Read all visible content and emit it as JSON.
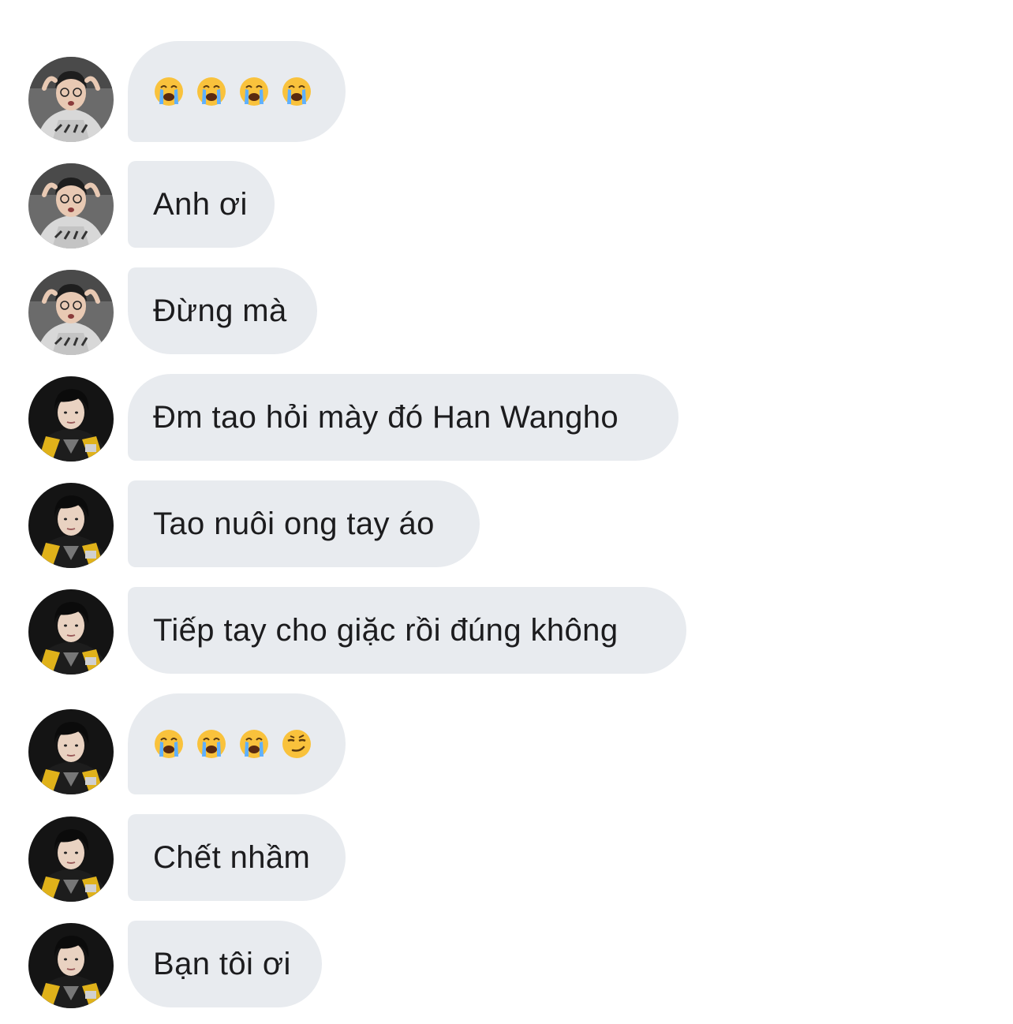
{
  "thread": {
    "messages": [
      {
        "sender": "person-a",
        "text": "😭 😭 😭 😭",
        "emojis": [
          "crying-face-emoji",
          "crying-face-emoji",
          "crying-face-emoji",
          "crying-face-emoji"
        ]
      },
      {
        "sender": "person-a",
        "text": "Anh ơi"
      },
      {
        "sender": "person-a",
        "text": "Đừng mà"
      },
      {
        "sender": "person-b",
        "text": "Đm tao hỏi mày đó Han Wangho"
      },
      {
        "sender": "person-b",
        "text": "Tao nuôi ong tay áo"
      },
      {
        "sender": "person-b",
        "text": "Tiếp tay cho giặc rồi đúng không"
      },
      {
        "sender": "person-b",
        "text": "😭 😭 😭 😏",
        "emojis": [
          "crying-face-emoji",
          "crying-face-emoji",
          "crying-face-emoji",
          "smirking-face-emoji"
        ]
      },
      {
        "sender": "person-b",
        "text": "Chết nhầm"
      },
      {
        "sender": "person-b",
        "text": "Bạn tôi ơi"
      }
    ]
  },
  "colors": {
    "bubble_background": "#e8ebef",
    "text": "#1c1c1e",
    "page_background": "#ffffff"
  }
}
